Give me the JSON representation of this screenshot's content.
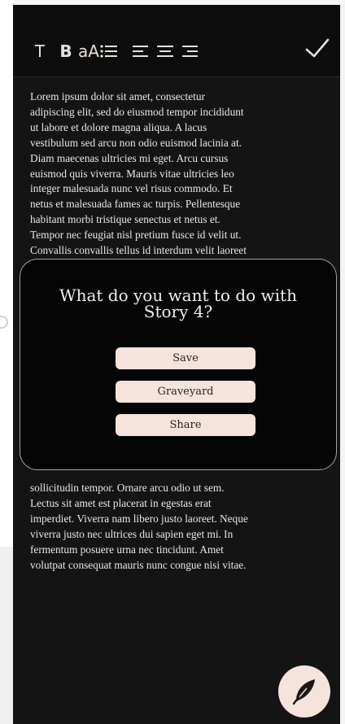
{
  "toolbar": {
    "text_tool_label": "T",
    "bold_tool_label": "B",
    "font_size_tool_label": "aA",
    "list_icon": "list-icon",
    "align_left_icon": "align-left-icon",
    "align_center_icon": "align-center-icon",
    "align_right_icon": "align-right-icon",
    "confirm_icon": "checkmark-icon"
  },
  "story": {
    "top_text": "Lorem ipsum dolor sit amet, consectetur\nadipiscing elit, sed do eiusmod tempor incididunt\nut labore et dolore magna aliqua. A lacus\nvestibulum sed arcu non odio euismod lacinia at.\nDiam maecenas ultricies mi eget. Arcu cursus\neuismod quis viverra. Mauris vitae ultricies leo\ninteger malesuada nunc vel risus commodo. Et\nnetus et malesuada fames ac turpis. Pellentesque\nhabitant morbi tristique senectus et netus et.\nTempor nec feugiat nisl pretium fusce id velit ut.\nConvallis convallis tellus id interdum velit laoreet",
    "bottom_text": "sollicitudin tempor. Ornare arcu odio ut sem.\nLectus sit amet est placerat in egestas erat\nimperdiet. Viverra nam libero justo laoreet. Neque\nviverra justo nec ultrices dui sapien eget mi. In\nfermentum posuere urna nec tincidunt. Amet\nvolutpat consequat mauris nunc congue nisi vitae."
  },
  "modal": {
    "title_line1": "What do you want to do with",
    "title_line2": "Story 4?",
    "buttons": [
      "Save",
      "Graveyard",
      "Share"
    ]
  },
  "fab": {
    "icon": "quill-icon"
  },
  "colors": {
    "background": "#141414",
    "toolbar": "#0d0d0d",
    "accent": "#f4e4dc",
    "text": "#ece7e2"
  }
}
